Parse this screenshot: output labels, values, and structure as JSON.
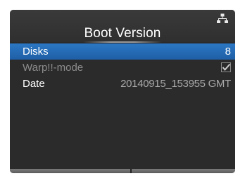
{
  "header": {
    "title": "Boot Version",
    "icon": "network-icon"
  },
  "rows": [
    {
      "label": "Disks",
      "value": "8",
      "selected": true
    },
    {
      "label": "Warp!!-mode",
      "value_icon": "checkbox-checked-icon",
      "checked": true,
      "disabled": true
    },
    {
      "label": "Date",
      "value": "20140915_153955 GMT"
    }
  ],
  "colors": {
    "screen_bg": "#2b2b2b",
    "selected_row": "#2669b4",
    "disabled_text": "#8c8c8c"
  }
}
